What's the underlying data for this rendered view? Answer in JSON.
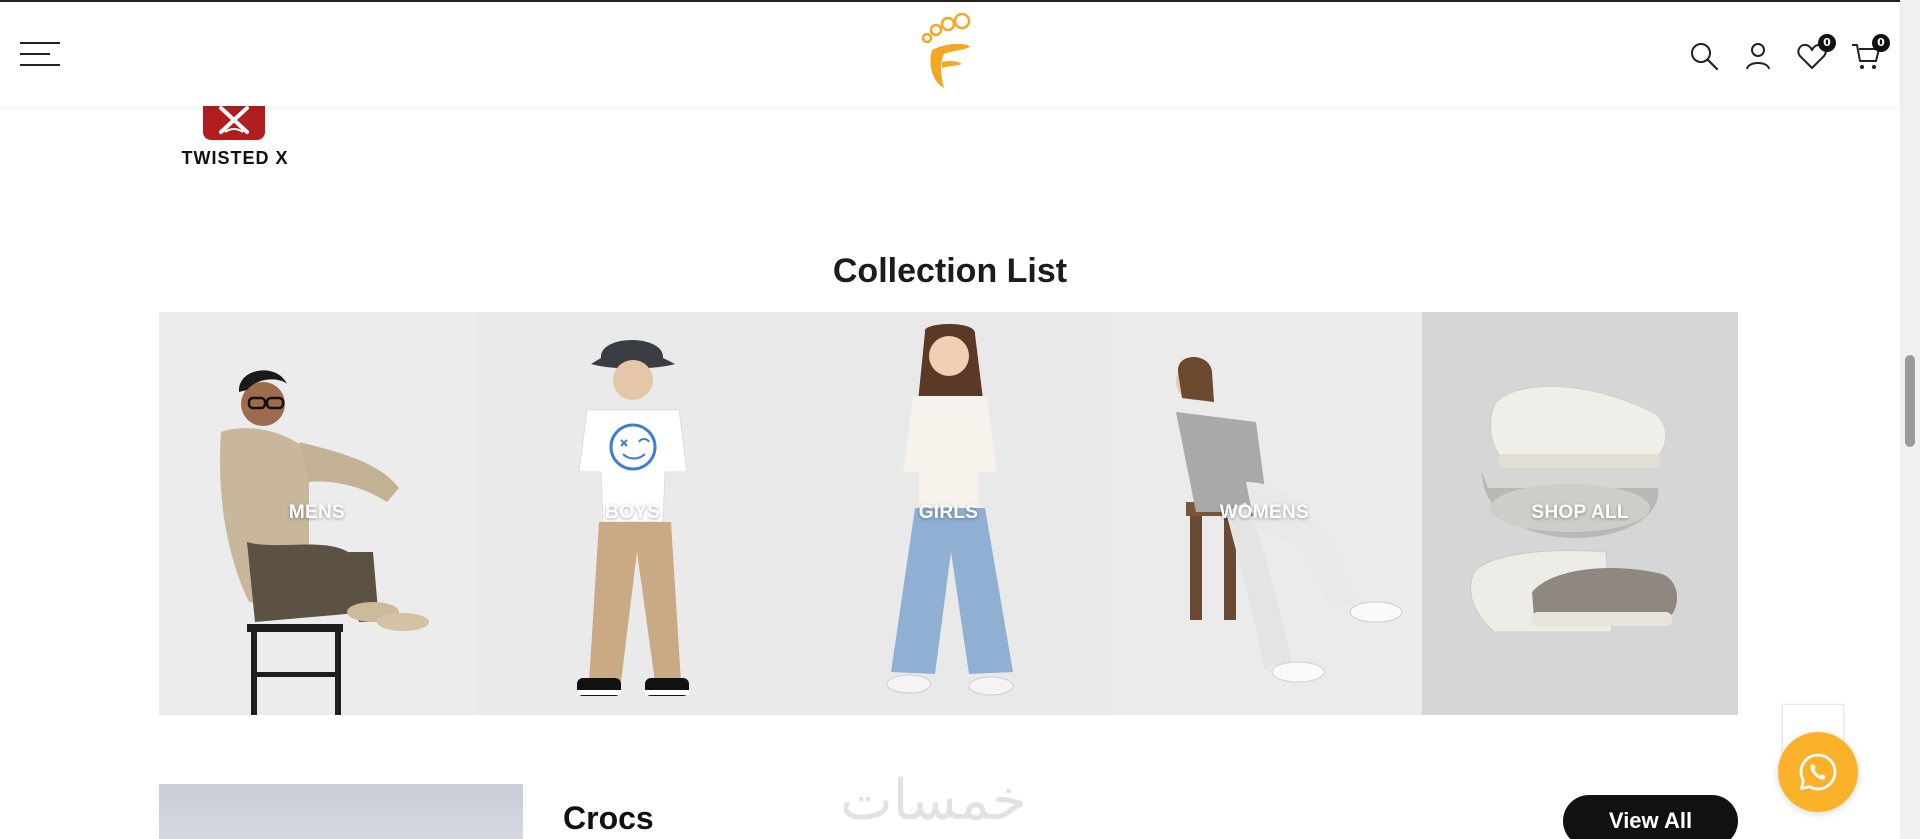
{
  "header": {
    "wishlist_count": "0",
    "cart_count": "0"
  },
  "brand": {
    "name": "TWISTED X"
  },
  "collection": {
    "title": "Collection List",
    "tiles": [
      {
        "label": "MENS"
      },
      {
        "label": "BOYS"
      },
      {
        "label": "GIRLS"
      },
      {
        "label": "WOMENS"
      },
      {
        "label": "SHOP ALL"
      }
    ]
  },
  "next_section": {
    "title": "Crocs",
    "view_all_label": "View All"
  },
  "watermark": {
    "text": "خمسات"
  },
  "colors": {
    "accent": "#fbb22a",
    "logo": "#f5a623",
    "brand_red": "#b01e1f",
    "button": "#111111"
  },
  "icons": [
    "menu-icon",
    "search-icon",
    "account-icon",
    "wishlist-icon",
    "cart-icon",
    "whatsapp-icon",
    "arrow-up-icon"
  ]
}
